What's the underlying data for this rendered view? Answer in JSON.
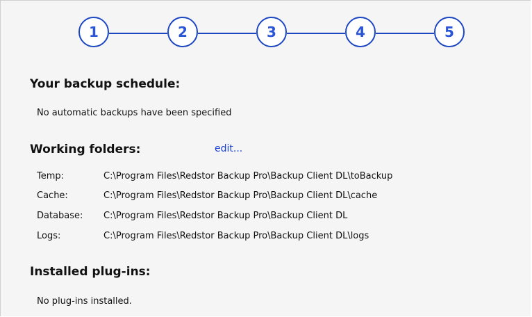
{
  "steps": [
    {
      "label": "1"
    },
    {
      "label": "2"
    },
    {
      "label": "3"
    },
    {
      "label": "4"
    },
    {
      "label": "5"
    }
  ],
  "schedule": {
    "heading": "Your backup schedule:",
    "text": "No automatic backups have been specified"
  },
  "folders": {
    "heading": "Working folders:",
    "edit_label": "edit...",
    "rows": [
      {
        "label": "Temp:",
        "path": "C:\\Program Files\\Redstor Backup Pro\\Backup Client DL\\toBackup"
      },
      {
        "label": "Cache:",
        "path": "C:\\Program Files\\Redstor Backup Pro\\Backup Client DL\\cache"
      },
      {
        "label": "Database:",
        "path": "C:\\Program Files\\Redstor Backup Pro\\Backup Client DL"
      },
      {
        "label": "Logs:",
        "path": "C:\\Program Files\\Redstor Backup Pro\\Backup Client DL\\logs"
      }
    ]
  },
  "plugins": {
    "heading": "Installed plug-ins:",
    "text": "No plug-ins installed."
  },
  "colors": {
    "accent": "#1c46c2",
    "panel_bg": "#f5f5f5",
    "link": "#1a3fd1"
  }
}
